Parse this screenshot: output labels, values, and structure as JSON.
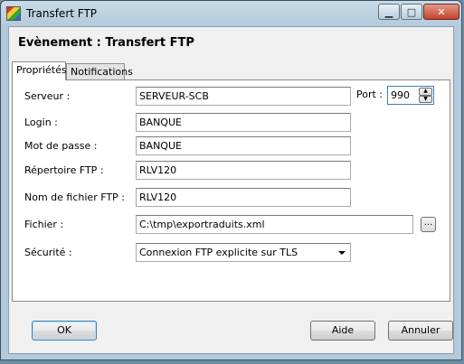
{
  "window": {
    "title": "Transfert FTP",
    "close_glyph": "✕",
    "min_glyph": "▁",
    "max_glyph": "□"
  },
  "header": {
    "title": "Evènement : Transfert FTP"
  },
  "tabs": [
    {
      "label": "Propriétés",
      "active": true
    },
    {
      "label": "Notifications",
      "active": false
    }
  ],
  "form": {
    "server_label": "Serveur :",
    "server_value": "SERVEUR-SCB",
    "port_label": "Port :",
    "port_value": "990",
    "login_label": "Login :",
    "login_value": "BANQUE",
    "password_label": "Mot de passe :",
    "password_value": "BANQUE",
    "ftp_dir_label": "Répertoire FTP :",
    "ftp_dir_value": "RLV120",
    "ftp_file_label": "Nom de fichier FTP :",
    "ftp_file_value": "RLV120",
    "file_label": "Fichier :",
    "file_value": "C:\\tmp\\exportraduits.xml",
    "browse_label": "...",
    "security_label": "Sécurité :",
    "security_value": "Connexion FTP explicite sur TLS"
  },
  "buttons": {
    "ok": "OK",
    "help": "Aide",
    "cancel": "Annuler"
  },
  "icons": {
    "app": "app-icon",
    "spin_up": "▲",
    "spin_down": "▼"
  }
}
